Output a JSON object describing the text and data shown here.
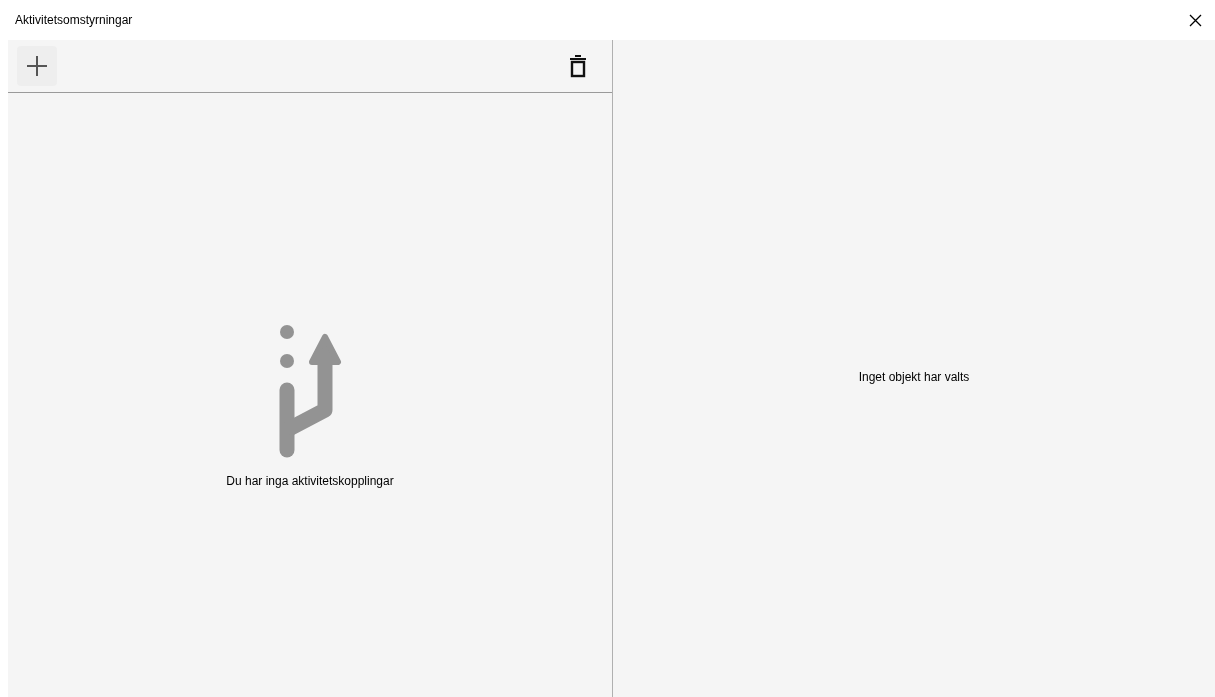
{
  "window": {
    "title": "Aktivitetsomstyrningar"
  },
  "left_pane": {
    "empty_message": "Du har inga aktivitetskopplingar"
  },
  "right_pane": {
    "empty_message": "Inget objekt har valts"
  }
}
